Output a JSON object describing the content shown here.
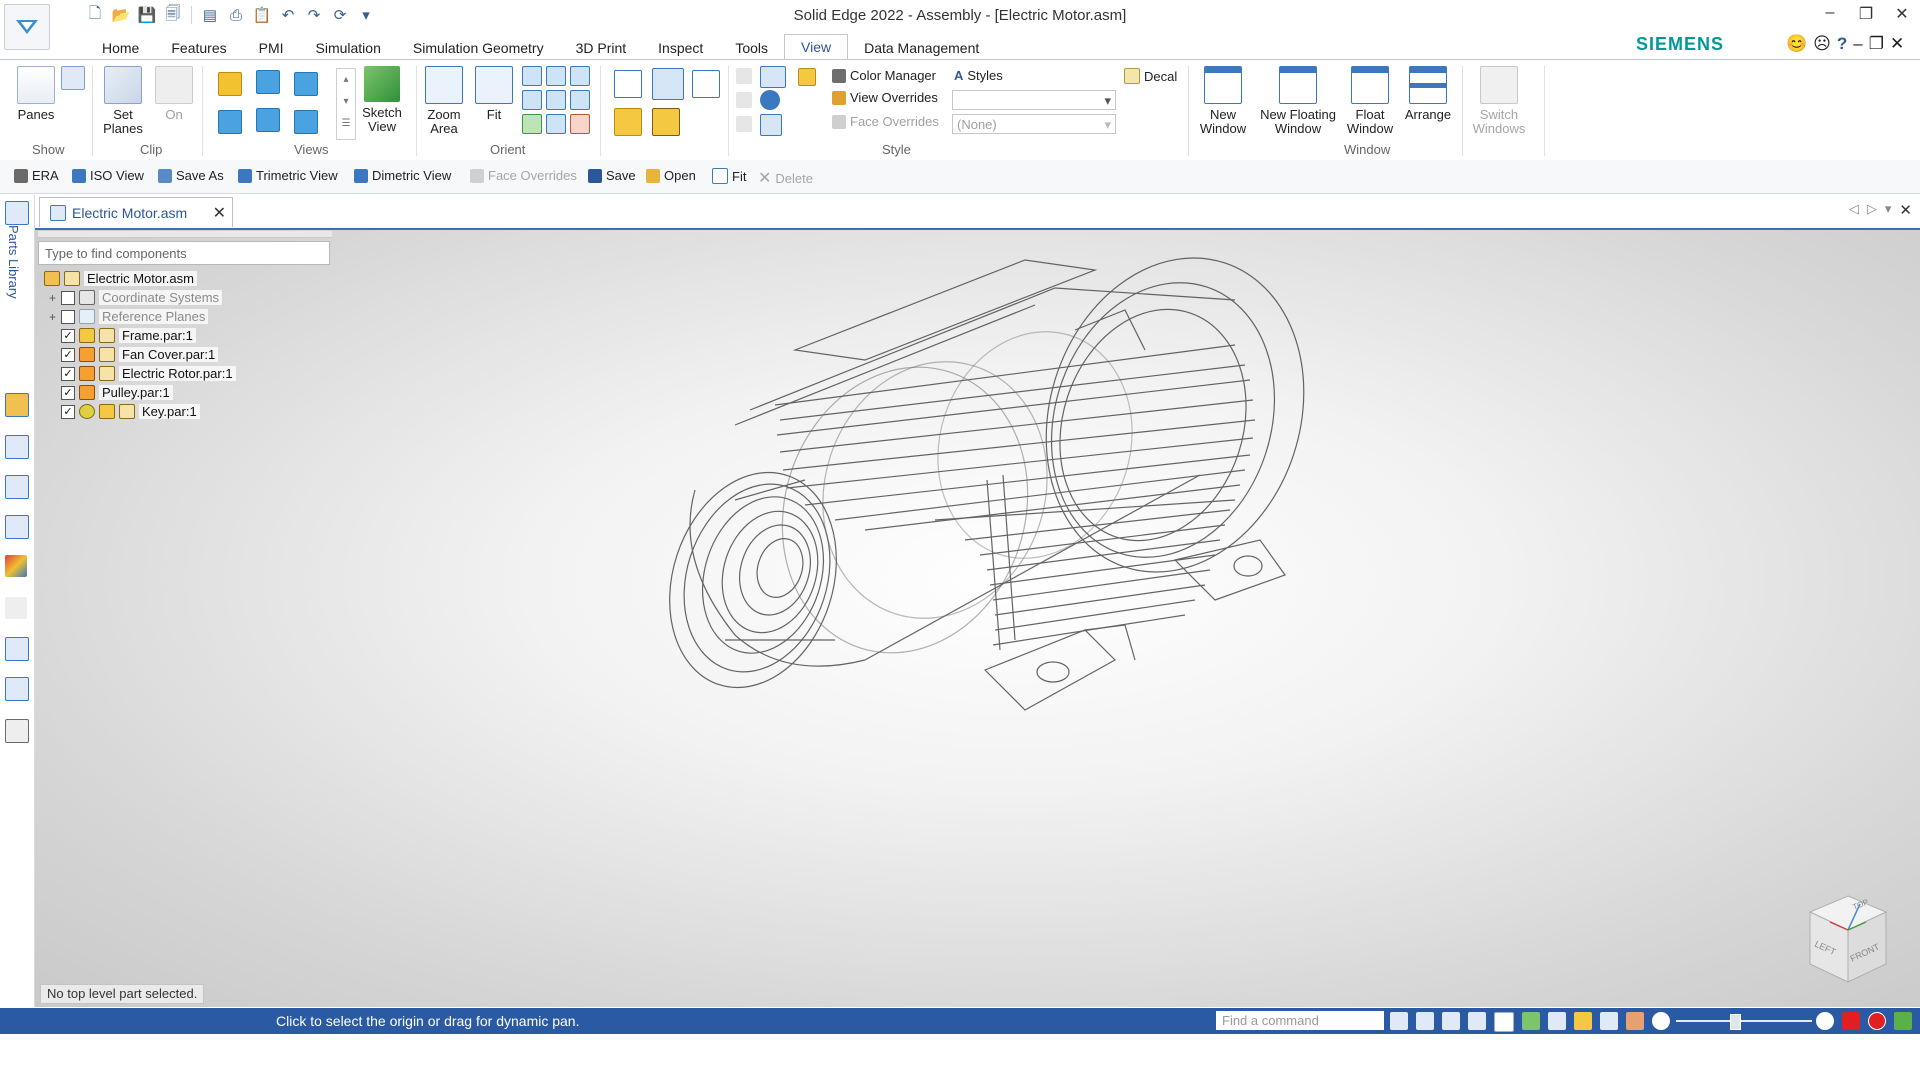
{
  "window": {
    "title": "Solid Edge 2022 - Assembly - [Electric Motor.asm]",
    "controls": [
      "–",
      "❐",
      "✕"
    ],
    "doc_controls": [
      "–",
      "❐",
      "✕"
    ]
  },
  "brand": "SIEMENS",
  "tabs": [
    "Home",
    "Features",
    "PMI",
    "Simulation",
    "Simulation Geometry",
    "3D Print",
    "Inspect",
    "Tools",
    "View",
    "Data Management"
  ],
  "active_tab": "View",
  "ribbon": {
    "show": {
      "panes": "Panes",
      "group": "Show"
    },
    "clip": {
      "set_planes": "Set Planes",
      "on": "On",
      "group": "Clip"
    },
    "views": {
      "sketch_view": "Sketch View",
      "group": "Views"
    },
    "orient": {
      "zoom_area": "Zoom Area",
      "fit": "Fit",
      "group": "Orient"
    },
    "style": {
      "color_manager": "Color Manager",
      "styles": "Styles",
      "view_overrides": "View Overrides",
      "face_overrides": "Face Overrides",
      "face_overrides_value": "(None)",
      "decal": "Decal",
      "group": "Style"
    },
    "window": {
      "new_window": "New Window",
      "new_floating_window": "New Floating Window",
      "float_window": "Float Window",
      "arrange": "Arrange",
      "switch_windows": "Switch Windows",
      "group": "Window"
    }
  },
  "viewbar": {
    "era": "ERA",
    "iso_view": "ISO View",
    "save_as": "Save As",
    "trimetric": "Trimetric View",
    "dimetric": "Dimetric View",
    "face_overrides": "Face Overrides",
    "save": "Save",
    "open": "Open",
    "fit": "Fit",
    "delete": "Delete"
  },
  "sidebar": {
    "parts_library": "Parts Library"
  },
  "document_tab": "Electric Motor.asm",
  "pathfinder": {
    "search_placeholder": "Type to find components",
    "root": "Electric Motor.asm",
    "items": [
      {
        "label": "Coordinate Systems",
        "checked": false,
        "expandable": true,
        "gray": true
      },
      {
        "label": "Reference Planes",
        "checked": false,
        "expandable": true,
        "gray": true
      },
      {
        "label": "Frame.par:1",
        "checked": true,
        "expandable": false,
        "gray": false
      },
      {
        "label": "Fan Cover.par:1",
        "checked": true,
        "expandable": false,
        "gray": false
      },
      {
        "label": "Electric Rotor.par:1",
        "checked": true,
        "expandable": false,
        "gray": false
      },
      {
        "label": "Pulley.par:1",
        "checked": true,
        "expandable": false,
        "gray": false
      },
      {
        "label": "Key.par:1",
        "checked": true,
        "expandable": false,
        "gray": false
      }
    ]
  },
  "status_box": "No top level part selected.",
  "statusbar": {
    "message": "Click to select the origin or drag for dynamic pan.",
    "find_placeholder": "Find a command"
  },
  "viewcube": {
    "top": "TOP",
    "left": "LEFT",
    "front": "FRONT"
  },
  "colors": {
    "accent": "#2b579a",
    "statusbar": "#2a5aa3",
    "brand": "#009999"
  }
}
